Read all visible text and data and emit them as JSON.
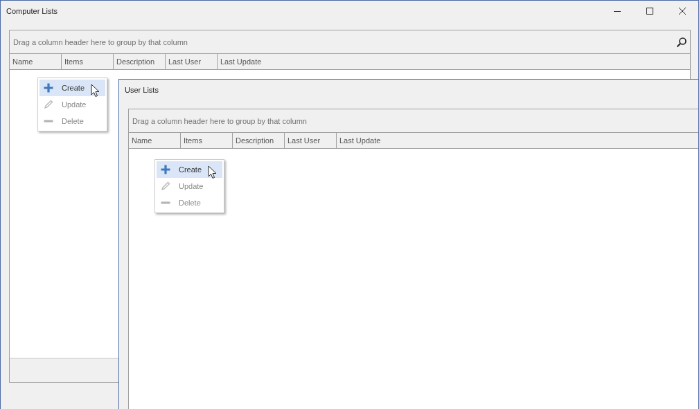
{
  "window": {
    "title": "Computer Lists"
  },
  "grid": {
    "group_panel": "Drag a column header here to group by that column",
    "columns": [
      "Name",
      "Items",
      "Description",
      "Last User",
      "Last Update"
    ]
  },
  "context_menu": {
    "items": [
      {
        "label": "Create",
        "kind": "create",
        "selected": true,
        "disabled": false
      },
      {
        "label": "Update",
        "kind": "update",
        "selected": false,
        "disabled": true
      },
      {
        "label": "Delete",
        "kind": "delete",
        "selected": false,
        "disabled": true
      }
    ]
  },
  "child_window": {
    "title": "User Lists",
    "grid": {
      "group_panel": "Drag a column header here to group by that column",
      "columns": [
        "Name",
        "Items",
        "Description",
        "Last User",
        "Last Update"
      ]
    },
    "context_menu": {
      "items": [
        {
          "label": "Create",
          "kind": "create",
          "selected": true,
          "disabled": false
        },
        {
          "label": "Update",
          "kind": "update",
          "selected": false,
          "disabled": true
        },
        {
          "label": "Delete",
          "kind": "delete",
          "selected": false,
          "disabled": true
        }
      ]
    }
  }
}
